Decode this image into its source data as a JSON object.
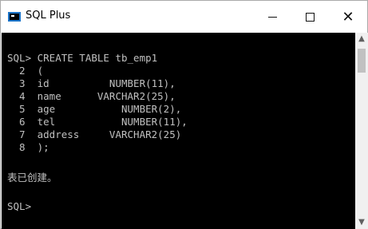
{
  "window": {
    "title": "SQL Plus"
  },
  "controls": {
    "minimize": "—",
    "maximize": "",
    "close": "✕"
  },
  "console": {
    "lines": [
      "SQL> CREATE TABLE tb_emp1",
      "  2  (",
      "  3  id          NUMBER(11),",
      "  4  name      VARCHAR2(25),",
      "  5  age           NUMBER(2),",
      "  6  tel           NUMBER(11),",
      "  7  address     VARCHAR2(25)",
      "  8  );",
      "",
      "表已创建。",
      "",
      "SQL>"
    ]
  },
  "scrollbar": {
    "up_arrow": "▲",
    "down_arrow": "▼"
  }
}
